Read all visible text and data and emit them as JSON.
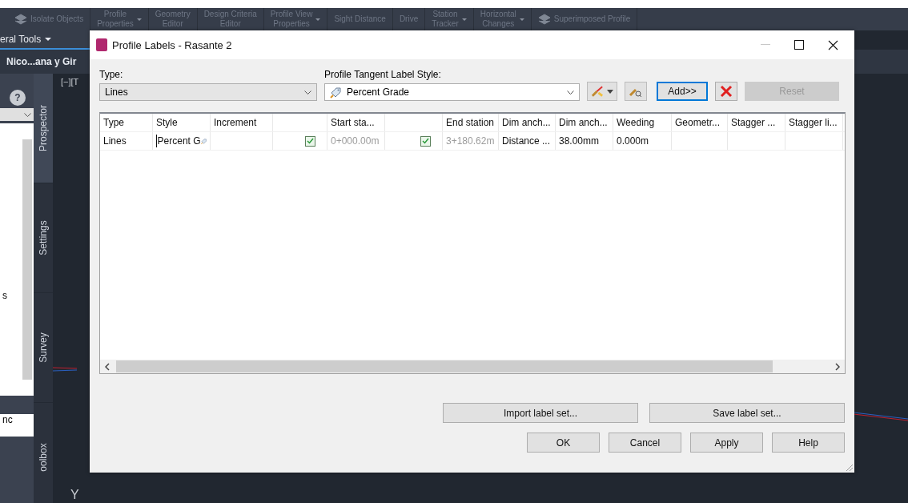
{
  "ribbon": {
    "items": [
      {
        "bottom": "Isolate Objects",
        "icon": true,
        "menu": false
      },
      {
        "top": "Profile",
        "bottom": "Properties",
        "icon": false,
        "menu": true
      },
      {
        "top": "Geometry",
        "bottom": "Editor",
        "icon": false,
        "menu": false
      },
      {
        "top": "Design Criteria",
        "bottom": "Editor",
        "icon": false,
        "menu": false
      },
      {
        "top": "Profile View",
        "bottom": "Properties",
        "icon": false,
        "menu": true
      },
      {
        "top": "Sight Distance",
        "icon": false,
        "menu": false
      },
      {
        "top": "Drive",
        "icon": false,
        "menu": false
      },
      {
        "top": "Station",
        "bottom": "Tracker",
        "icon": false,
        "menu": true
      },
      {
        "top": "Horizontal",
        "bottom": "Changes",
        "icon": false,
        "menu": true
      },
      {
        "bottom": "Superimposed Profile",
        "icon": true,
        "menu": false
      }
    ]
  },
  "panel_title": "eral Tools",
  "drawing_tab": "Nico...ana y Gir",
  "viewport_label": "[−][T",
  "palette": {
    "help": "?",
    "fragments": [
      "s",
      "nc"
    ],
    "tabs": [
      {
        "label": "Prospector",
        "selected": true
      },
      {
        "label": "Settings",
        "selected": false
      },
      {
        "label": "Survey",
        "selected": false
      },
      {
        "label": "oolbox",
        "selected": false
      }
    ]
  },
  "axis_label": "Y",
  "dialog": {
    "title": "Profile Labels - Rasante 2",
    "type_label": "Type:",
    "type_value": "Lines",
    "style_label": "Profile Tangent Label Style:",
    "style_value": "Percent Grade",
    "buttons": [
      {
        "kind": "add",
        "label": "Add>>",
        "default": true,
        "disabled": false
      },
      {
        "kind": "delete",
        "default": false,
        "disabled": false
      },
      {
        "kind": "reset",
        "label": "Reset",
        "default": false,
        "disabled": true
      }
    ],
    "table": {
      "columns": [
        "Type",
        "Style",
        "Increment",
        "",
        "Start sta...",
        "",
        "End station",
        "Dim anch...",
        "Dim anch...",
        "Weeding",
        "Geometr...",
        "Stagger ...",
        "Stagger li..."
      ],
      "rows": [
        [
          {
            "kind": "text",
            "text": "Lines"
          },
          {
            "kind": "style",
            "text": "Percent G"
          },
          {
            "kind": "empty"
          },
          {
            "kind": "check",
            "checked": true
          },
          {
            "kind": "readonly",
            "text": "0+000.00m"
          },
          {
            "kind": "check",
            "checked": true
          },
          {
            "kind": "readonly",
            "text": "3+180.62m"
          },
          {
            "kind": "text",
            "text": "Distance ..."
          },
          {
            "kind": "text",
            "text": "38.00mm"
          },
          {
            "kind": "text",
            "text": "0.000m"
          },
          {
            "kind": "empty"
          },
          {
            "kind": "empty"
          },
          {
            "kind": "empty"
          }
        ]
      ]
    },
    "set_buttons": [
      "Import label set...",
      "Save label set..."
    ],
    "footer_buttons": [
      "OK",
      "Cancel",
      "Apply",
      "Help"
    ]
  }
}
